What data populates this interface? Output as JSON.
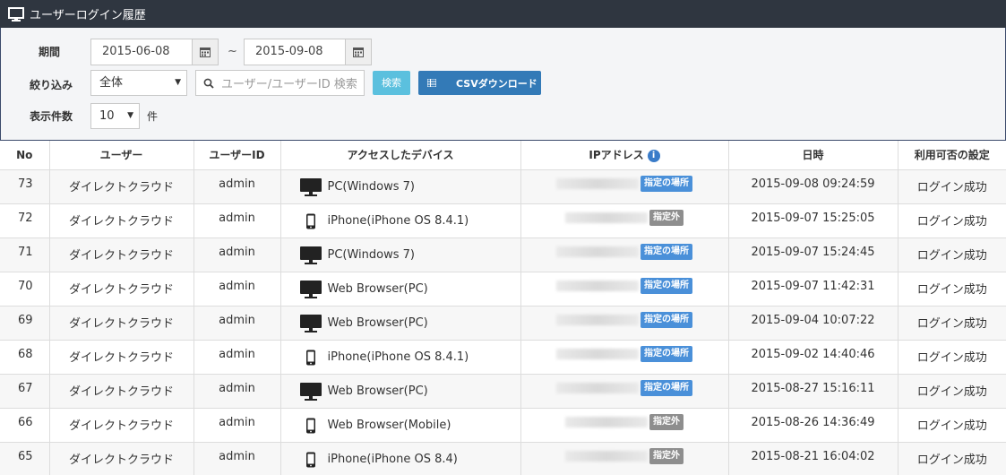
{
  "header": {
    "title": "ユーザーログイン履歴",
    "icon": "monitor-icon"
  },
  "filter": {
    "period_label": "期間",
    "date_from": "2015-06-08",
    "tilde": "~",
    "date_to": "2015-09-08",
    "narrow_label": "絞り込み",
    "narrow_value": "全体",
    "search_placeholder": "ユーザー/ユーザーID 検索",
    "search_button": "検索",
    "csv_button": "CSVダウンロード",
    "count_label": "表示件数",
    "count_value": "10",
    "count_unit": "件"
  },
  "table": {
    "headers": [
      "No",
      "ユーザー",
      "ユーザーID",
      "アクセスしたデバイス",
      "IPアドレス",
      "日時",
      "利用可否の設定"
    ],
    "rows": [
      {
        "no": "73",
        "user": "ダイレクトクラウド",
        "id": "admin",
        "device_type": "pc",
        "device": "PC(Windows 7)",
        "badge": "指定の場所",
        "badge_type": "blue",
        "datetime": "2015-09-08 09:24:59",
        "status": "ログイン成功"
      },
      {
        "no": "72",
        "user": "ダイレクトクラウド",
        "id": "admin",
        "device_type": "phone",
        "device": "iPhone(iPhone OS 8.4.1)",
        "badge": "指定外",
        "badge_type": "grey",
        "datetime": "2015-09-07 15:25:05",
        "status": "ログイン成功"
      },
      {
        "no": "71",
        "user": "ダイレクトクラウド",
        "id": "admin",
        "device_type": "pc",
        "device": "PC(Windows 7)",
        "badge": "指定の場所",
        "badge_type": "blue",
        "datetime": "2015-09-07 15:24:45",
        "status": "ログイン成功"
      },
      {
        "no": "70",
        "user": "ダイレクトクラウド",
        "id": "admin",
        "device_type": "pc",
        "device": "Web Browser(PC)",
        "badge": "指定の場所",
        "badge_type": "blue",
        "datetime": "2015-09-07 11:42:31",
        "status": "ログイン成功"
      },
      {
        "no": "69",
        "user": "ダイレクトクラウド",
        "id": "admin",
        "device_type": "pc",
        "device": "Web Browser(PC)",
        "badge": "指定の場所",
        "badge_type": "blue",
        "datetime": "2015-09-04 10:07:22",
        "status": "ログイン成功"
      },
      {
        "no": "68",
        "user": "ダイレクトクラウド",
        "id": "admin",
        "device_type": "phone",
        "device": "iPhone(iPhone OS 8.4.1)",
        "badge": "指定の場所",
        "badge_type": "blue",
        "datetime": "2015-09-02 14:40:46",
        "status": "ログイン成功"
      },
      {
        "no": "67",
        "user": "ダイレクトクラウド",
        "id": "admin",
        "device_type": "pc",
        "device": "Web Browser(PC)",
        "badge": "指定の場所",
        "badge_type": "blue",
        "datetime": "2015-08-27 15:16:11",
        "status": "ログイン成功"
      },
      {
        "no": "66",
        "user": "ダイレクトクラウド",
        "id": "admin",
        "device_type": "phone",
        "device": "Web Browser(Mobile)",
        "badge": "指定外",
        "badge_type": "grey",
        "datetime": "2015-08-26 14:36:49",
        "status": "ログイン成功"
      },
      {
        "no": "65",
        "user": "ダイレクトクラウド",
        "id": "admin",
        "device_type": "phone",
        "device": "iPhone(iPhone OS 8.4)",
        "badge": "指定外",
        "badge_type": "grey",
        "datetime": "2015-08-21 16:04:02",
        "status": "ログイン成功"
      }
    ]
  },
  "colors": {
    "header_bg": "#2f3640",
    "badge_blue": "#4a90d9",
    "badge_grey": "#8e8e8e",
    "btn_search": "#5bc0de",
    "btn_csv": "#337ab7"
  }
}
